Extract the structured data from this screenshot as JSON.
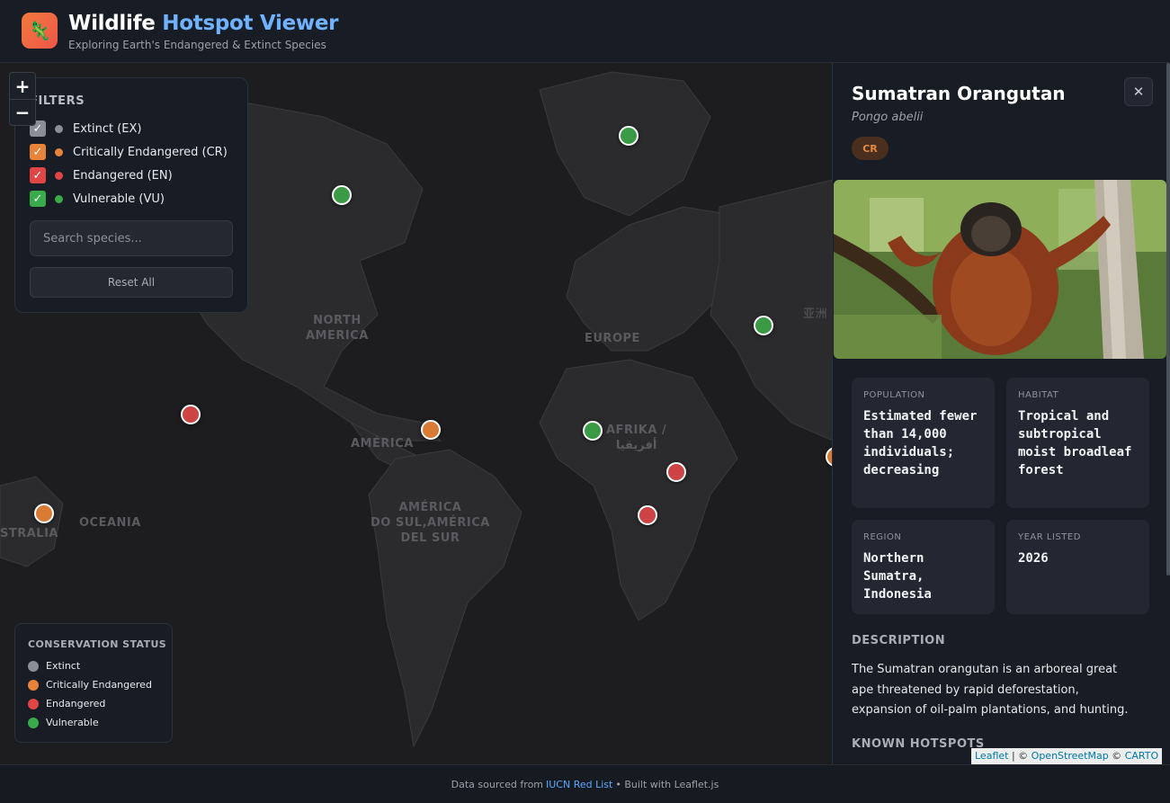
{
  "header": {
    "title_part1": "Wildlife ",
    "title_part2": "Hotspot Viewer",
    "subtitle": "Exploring Earth's Endangered & Extinct Species",
    "logo_icon": "🦎"
  },
  "map": {
    "zoom_in": "+",
    "zoom_out": "−",
    "labels": {
      "north_america": "NORTH\nAMERICA",
      "europe": "EUROPE",
      "america": "AMÉRICA",
      "south_america": "AMÉRICA\nDO SUL,AMÉRICA\nDEL SUR",
      "africa": "AFRIKA /\nأفريقيا",
      "oceania": "OCEANIA",
      "australia": "STRALIA",
      "asia": "亚洲"
    },
    "attribution": {
      "leaflet": "Leaflet",
      "sep": " | © ",
      "osm": "OpenStreetMap",
      "sep2": " © ",
      "carto": "CARTO"
    }
  },
  "filters": {
    "title": "FILTERS",
    "items": [
      {
        "label": "Extinct (EX)",
        "color": "#8a8e96",
        "checked": true
      },
      {
        "label": "Critically Endangered (CR)",
        "color": "#e8843a",
        "checked": true
      },
      {
        "label": "Endangered (EN)",
        "color": "#e04646",
        "checked": true
      },
      {
        "label": "Vulnerable (VU)",
        "color": "#3aab4a",
        "checked": true
      }
    ],
    "search_placeholder": "Search species...",
    "reset_label": "Reset All"
  },
  "legend": {
    "title": "CONSERVATION STATUS",
    "items": [
      {
        "label": "Extinct",
        "color": "#8a8e96"
      },
      {
        "label": "Critically Endangered",
        "color": "#e8843a"
      },
      {
        "label": "Endangered",
        "color": "#e04646"
      },
      {
        "label": "Vulnerable",
        "color": "#3aab4a"
      }
    ]
  },
  "species": {
    "name": "Sumatran Orangutan",
    "scientific": "Pongo abelii",
    "status_code": "CR",
    "close_icon": "✕",
    "stats": {
      "population": {
        "label": "POPULATION",
        "value": "Estimated fewer than 14,000 individuals; decreasing"
      },
      "habitat": {
        "label": "HABITAT",
        "value": "Tropical and subtropical moist broadleaf forest"
      },
      "region": {
        "label": "REGION",
        "value": "Northern Sumatra, Indonesia"
      },
      "year": {
        "label": "YEAR LISTED",
        "value": "2026"
      }
    },
    "description_title": "DESCRIPTION",
    "description": "The Sumatran orangutan is an arboreal great ape threatened by rapid deforestation, expansion of oil-palm plantations, and hunting.",
    "hotspots_title": "KNOWN HOTSPOTS"
  },
  "footer": {
    "prefix": "Data sourced from",
    "link": "IUCN Red List",
    "suffix": "• Built with Leaflet.js"
  }
}
